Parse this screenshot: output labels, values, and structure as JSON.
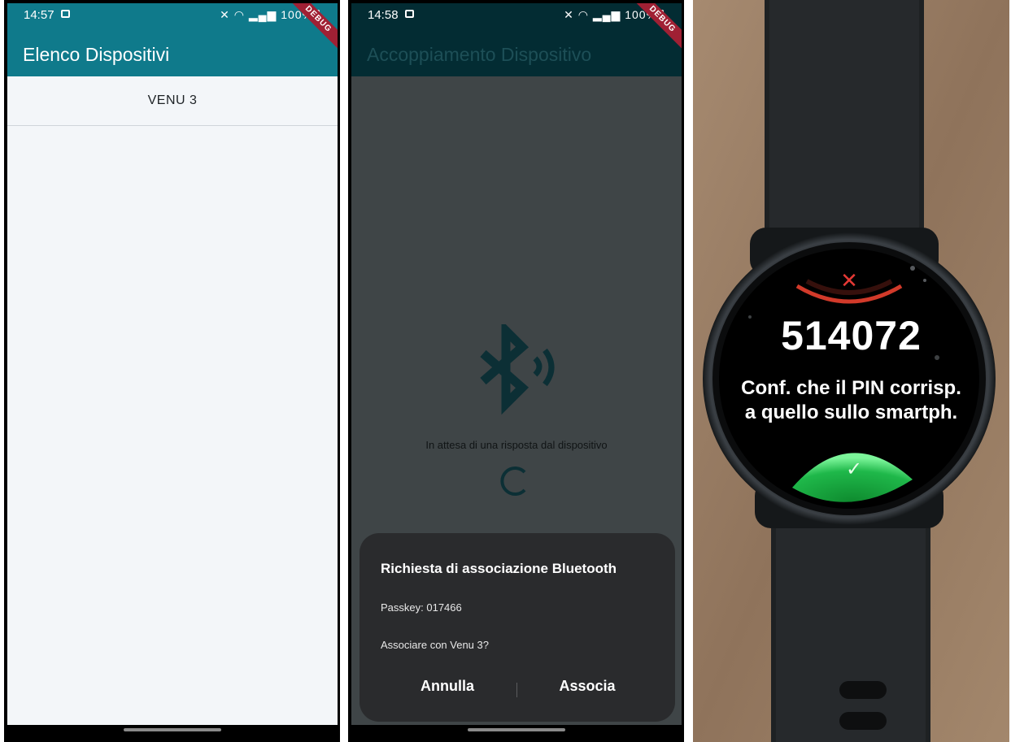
{
  "panel1": {
    "status": {
      "time": "14:57",
      "battery": "100%"
    },
    "app_title": "Elenco Dispositivi",
    "debug_label": "DEBUG",
    "devices": [
      {
        "name": "VENU 3"
      }
    ]
  },
  "panel2": {
    "status": {
      "time": "14:58",
      "battery": "100%"
    },
    "app_title": "Accoppiamento Dispositivo",
    "debug_label": "DEBUG",
    "waiting_text": "In attesa di una risposta dal dispositivo",
    "dialog": {
      "title": "Richiesta di associazione Bluetooth",
      "passkey": "Passkey: 017466",
      "question": "Associare con Venu 3?",
      "cancel_label": "Annulla",
      "confirm_label": "Associa"
    }
  },
  "panel3": {
    "pin": "514072",
    "line1": "Conf. che il PIN corrisp.",
    "line2": "a quello sullo smartph."
  },
  "colors": {
    "app_bar": "#0f7a8b",
    "app_bar_dimmed": "#032c33",
    "background": "#f3f6f9",
    "dialog": "#2a2b2d",
    "watch_accept": "#22c55e",
    "watch_reject": "#e53935"
  }
}
